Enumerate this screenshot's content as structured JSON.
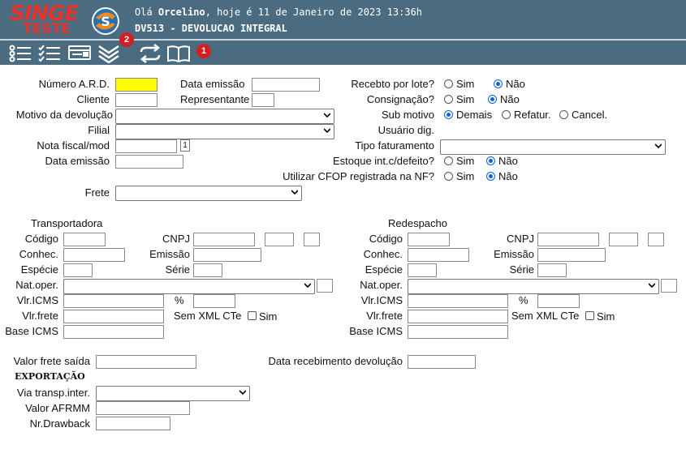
{
  "header": {
    "brand_top": "SINGE",
    "brand_bottom": "TESTE",
    "greet_prefix": "Olá ",
    "user": "Orcelino",
    "greet_suffix": ", hoje é 11 de Janeiro de 2023 13:36h",
    "screen_title": "DV513 - DEVOLUCAO INTEGRAL"
  },
  "toolbar": {
    "items": [
      "list-icon",
      "checklist-icon",
      "form-icon",
      "collapse-icon",
      "refresh-icon",
      "book-icon"
    ],
    "badge_refresh": "2",
    "badge_book": "1"
  },
  "form": {
    "numero_ard_label": "Número A.R.D.",
    "cliente_label": "Cliente",
    "motivo_label": "Motivo da devolução",
    "filial_label": "Filial",
    "nota_fiscal_label": "Nota fiscal/mod",
    "nota_fiscal_mod": "1",
    "data_emissao_label": "Data emissão",
    "data_emissao2_label": "Data emissão",
    "representante_label": "Representante",
    "frete_label": "Frete",
    "recebto_lote_label": "Recebto por lote?",
    "consignacao_label": "Consignação?",
    "sub_motivo_label": "Sub motivo",
    "usuario_dig_label": "Usuário dig.",
    "tipo_fat_label": "Tipo faturamento",
    "estoque_label": "Estoque int.c/defeito?",
    "cfop_label": "Utilizar CFOP registrada na NF?",
    "sim": "Sim",
    "nao": "Não",
    "sub_demais": "Demais",
    "sub_refatur": "Refatur.",
    "sub_cancel": "Cancel."
  },
  "transportadora": {
    "title": "Transportadora",
    "codigo": "Código",
    "cnpj": "CNPJ",
    "conhec": "Conhec.",
    "emissao": "Emissão",
    "especie": "Espécie",
    "serie": "Série",
    "nat_oper": "Nat.oper.",
    "vlr_icms": "Vlr.ICMS",
    "pct": "%",
    "vlr_frete": "Vlr.frete",
    "sem_xml": "Sem XML CTe",
    "sim": "Sim",
    "base_icms": "Base ICMS"
  },
  "redespacho": {
    "title": "Redespacho",
    "codigo": "Código",
    "cnpj": "CNPJ",
    "conhec": "Conhec.",
    "emissao": "Emissão",
    "especie": "Espécie",
    "serie": "Série",
    "nat_oper": "Nat.oper.",
    "vlr_icms": "Vlr.ICMS",
    "pct": "%",
    "vlr_frete": "Vlr.frete",
    "sem_xml": "Sem XML CTe",
    "sim": "Sim",
    "base_icms": "Base ICMS"
  },
  "bottom": {
    "valor_frete_saida": "Valor frete saída",
    "data_receb_dev": "Data recebimento devolução",
    "exportacao": "EXPORTAÇÃO",
    "via_transp": "Via transp.inter.",
    "valor_afrmm": "Valor AFRMM",
    "nr_drawback": "Nr.Drawback"
  },
  "colors": {
    "header_bg": "#4b6b80",
    "brand": "#e8332a",
    "badge": "#d22020",
    "highlight_input": "#ffff00",
    "radio_accent": "#0a64d6"
  }
}
